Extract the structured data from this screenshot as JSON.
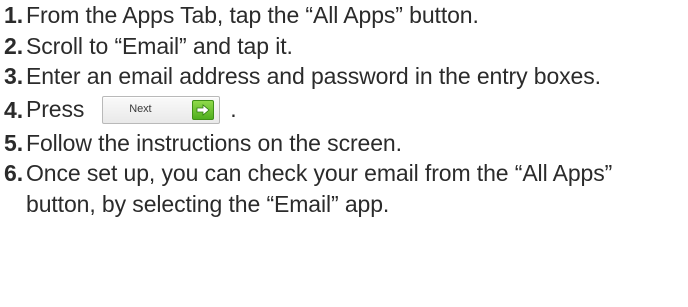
{
  "steps": [
    {
      "num": "1.",
      "text": "From the Apps Tab, tap the “All Apps” button."
    },
    {
      "num": "2.",
      "text": "Scroll to “Email” and tap it."
    },
    {
      "num": "3.",
      "text": "Enter an email address and password in the entry boxes."
    },
    {
      "num": "4.",
      "text_before": "Press",
      "text_after": "."
    },
    {
      "num": "5.",
      "text": "Follow the instructions on the screen."
    },
    {
      "num": "6.",
      "text": "Once set up, you can check your email from the “All Apps” button, by selecting the “Email” app."
    }
  ],
  "next_button": {
    "label": "Next",
    "icon": "green-arrow-right-icon",
    "accent": "#5cbf2a"
  }
}
